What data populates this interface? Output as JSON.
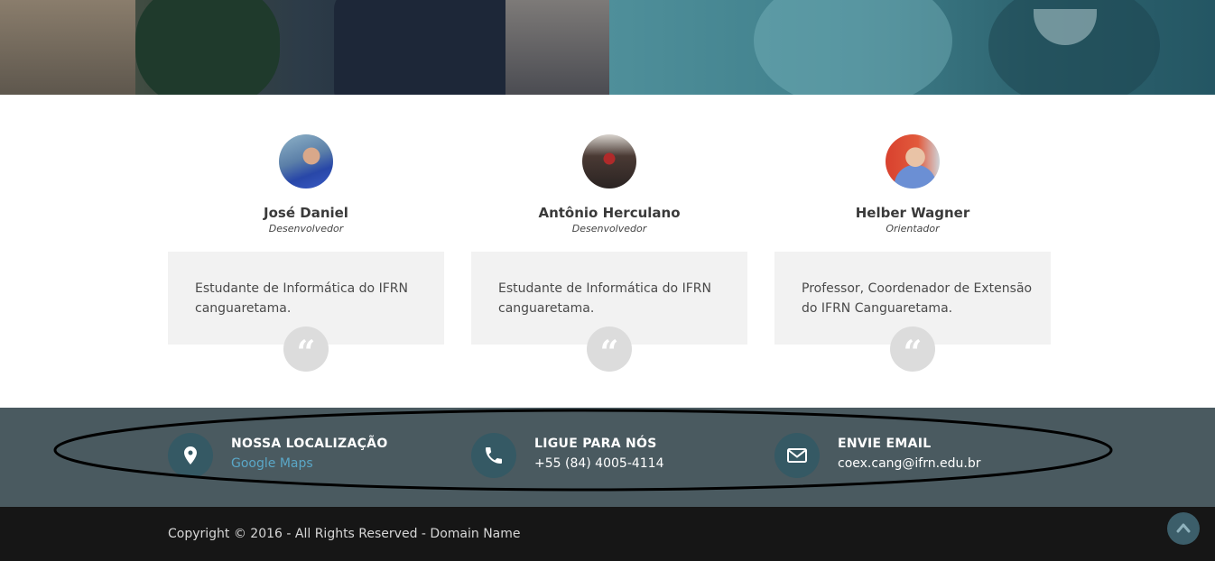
{
  "team": {
    "members": [
      {
        "name": "José Daniel",
        "role": "Desenvolvedor",
        "quote": "Estudante de Informática do IFRN canguaretama."
      },
      {
        "name": "Antônio Herculano",
        "role": "Desenvolvedor",
        "quote": "Estudante de Informática do IFRN canguaretama."
      },
      {
        "name": "Helber Wagner",
        "role": "Orientador",
        "quote": "Professor, Coordenador de Extensão do IFRN Canguaretama."
      }
    ],
    "quote_icon": "quote-icon"
  },
  "contact": {
    "location": {
      "title": "NOSSA LOCALIZAÇÃO",
      "value": "Google Maps",
      "icon": "map-pin-icon"
    },
    "phone": {
      "title": "LIGUE PARA NÓS",
      "value": "+55 (84) 4005-4114",
      "icon": "phone-icon"
    },
    "email": {
      "title": "ENVIE EMAIL",
      "value": "coex.cang@ifrn.edu.br",
      "icon": "envelope-icon"
    }
  },
  "footer": {
    "copyright": "Copyright © 2016 - All Rights Reserved - Domain Name",
    "scroll_top_icon": "chevron-up-icon"
  },
  "colors": {
    "contact_bg": "#4a5a60",
    "icon_circle": "#355964",
    "link": "#5aa7c7",
    "footer_bg": "#161616"
  }
}
